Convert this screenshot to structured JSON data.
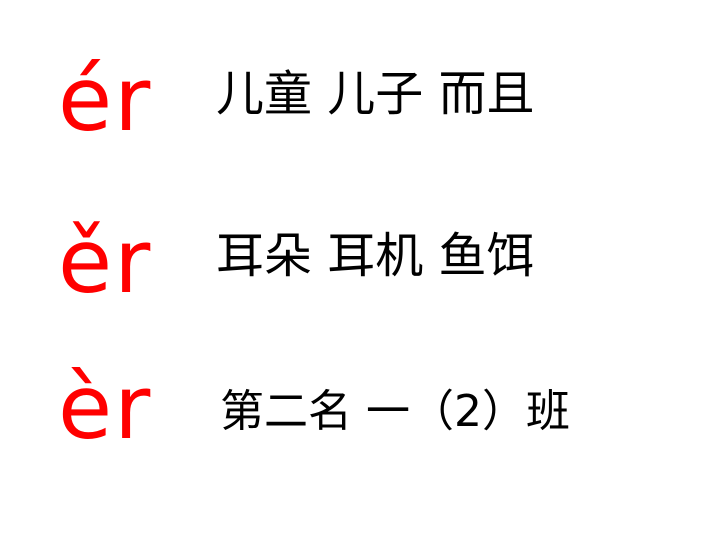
{
  "accent_color": "#ff0000",
  "text_color": "#000000",
  "rows": [
    {
      "pinyin": "ér",
      "words": "儿童 儿子 而且"
    },
    {
      "pinyin": "ěr",
      "words": "耳朵 耳机 鱼饵"
    },
    {
      "pinyin": "èr",
      "words": "第二名 一（2）班"
    }
  ]
}
